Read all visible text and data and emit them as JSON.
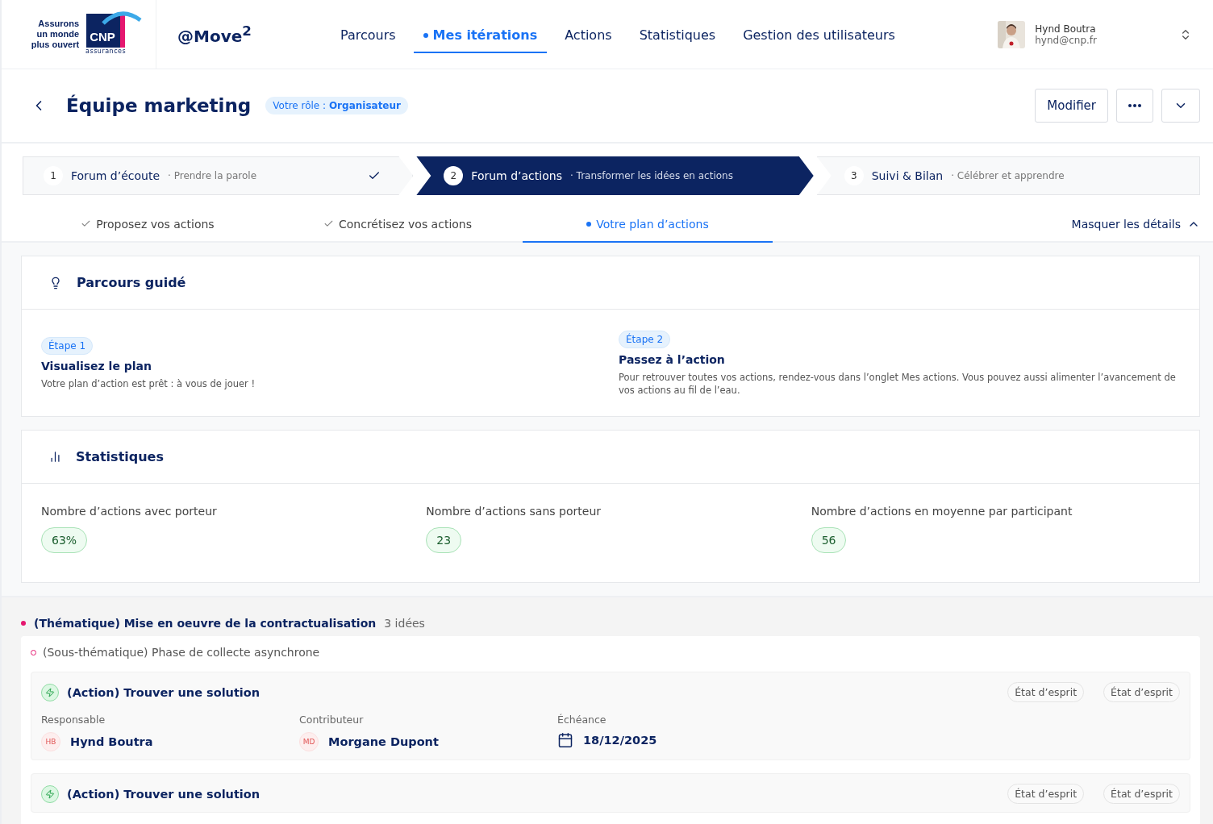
{
  "header": {
    "logo": {
      "tagline": [
        "Assurons",
        "un monde",
        "plus ouvert"
      ],
      "brand": "CNP",
      "sub": "assurances"
    },
    "app_name": "@Move",
    "app_sup": "2",
    "nav": [
      {
        "label": "Parcours",
        "selected": false
      },
      {
        "label": "Mes itérations",
        "selected": true
      },
      {
        "label": "Actions",
        "selected": false
      },
      {
        "label": "Statistiques",
        "selected": false
      },
      {
        "label": "Gestion des utilisateurs",
        "selected": false
      }
    ],
    "user": {
      "name": "Hynd Boutra",
      "email": "hynd@cnp.fr"
    }
  },
  "title_bar": {
    "title": "Équipe marketing",
    "role": "Votre rôle : **Organisateur**",
    "buttons": [
      "Modifier"
    ]
  },
  "stepper_separator": "·",
  "stepper": [
    {
      "number": "1",
      "title": "Forum d’écoute",
      "subtitle": "Prendre la parole",
      "selected": false,
      "done": true
    },
    {
      "number": "2",
      "title": "Forum d’actions",
      "subtitle": "Transformer les idées en actions",
      "selected": true,
      "done": false
    },
    {
      "number": "3",
      "title": "Suivi & Bilan",
      "subtitle": "Célébrer et apprendre",
      "selected": false,
      "done": false
    }
  ],
  "sub_tabs": [
    {
      "label": "Proposez vos actions",
      "done": true,
      "selected": false
    },
    {
      "label": "Concrétisez vos actions",
      "done": true,
      "selected": false
    },
    {
      "label": "Votre plan d’actions",
      "done": false,
      "selected": true
    }
  ],
  "details_toggle": {
    "label": "Masquer les détails",
    "expanded": true
  },
  "guide": {
    "title": "Parcours guidé",
    "steps": [
      {
        "badge": "Étape 1",
        "title": "Visualisez le plan",
        "text": "Votre plan d’action est prêt : à vous de jouer !"
      },
      {
        "badge": "Étape 2",
        "title": "Passez à l’action",
        "text": "Pour retrouver toutes vos actions, rendez-vous dans l’onglet Mes actions. Vous pouvez aussi alimenter l’avancement de vos actions au fil de l’eau."
      }
    ]
  },
  "statistics": {
    "title": "Statistiques",
    "items": [
      {
        "label": "Nombre d’actions avec porteur",
        "value": "63%"
      },
      {
        "label": "Nombre d’actions sans porteur",
        "value": "23"
      },
      {
        "label": "Nombre d’actions en moyenne par participant",
        "value": "56"
      }
    ]
  },
  "theme": {
    "title": "(Thématique) Mise en oeuvre de la contractualisation",
    "count": "3 idées",
    "color": "#e5176f",
    "subtheme": "(Sous-thématique) Phase de collecte asynchrone",
    "actions": [
      {
        "title": "(Action) Trouver une solution",
        "tags": [
          "État d’esprit",
          "État d’esprit"
        ],
        "fields": [
          {
            "kind": "person",
            "label": "Responsable",
            "initials": "HB",
            "value": "Hynd Boutra"
          },
          {
            "kind": "person",
            "label": "Contributeur",
            "initials": "MD",
            "value": "Morgane Dupont"
          },
          {
            "kind": "date",
            "label": "Échéance",
            "value": "18/12/2025"
          }
        ]
      },
      {
        "title": "(Action) Trouver une solution",
        "tags": [
          "État d’esprit",
          "État d’esprit"
        ]
      }
    ]
  }
}
